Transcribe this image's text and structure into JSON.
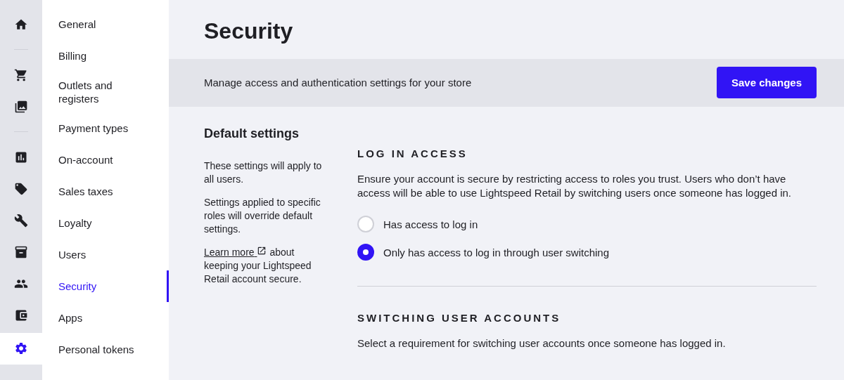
{
  "rail": [
    {
      "kind": "icon",
      "selected": false
    },
    {
      "kind": "divider"
    },
    {
      "kind": "icon",
      "selected": false
    },
    {
      "kind": "icon",
      "selected": false
    },
    {
      "kind": "divider"
    },
    {
      "kind": "icon",
      "selected": false
    },
    {
      "kind": "icon",
      "selected": false
    },
    {
      "kind": "icon",
      "selected": false
    },
    {
      "kind": "icon",
      "selected": false
    },
    {
      "kind": "icon",
      "selected": false
    },
    {
      "kind": "icon",
      "selected": false
    },
    {
      "kind": "icon",
      "selected": true
    }
  ],
  "nav": [
    {
      "label": "General",
      "selected": false
    },
    {
      "label": "Billing",
      "selected": false
    },
    {
      "label": "Outlets and registers",
      "selected": false
    },
    {
      "label": "Payment types",
      "selected": false
    },
    {
      "label": "On-account",
      "selected": false
    },
    {
      "label": "Sales taxes",
      "selected": false
    },
    {
      "label": "Loyalty",
      "selected": false
    },
    {
      "label": "Users",
      "selected": false
    },
    {
      "label": "Security",
      "selected": true
    },
    {
      "label": "Apps",
      "selected": false
    },
    {
      "label": "Personal tokens",
      "selected": false
    }
  ],
  "title": "Security",
  "banner": {
    "description": "Manage access and authentication settings for your store",
    "button": "Save changes"
  },
  "aside": {
    "heading": "Default settings",
    "paragraphs": [
      "These settings will apply to all users.",
      "Settings applied to specific roles will override default settings."
    ],
    "link": "Learn more",
    "link_suffix": "about keeping your Lightspeed Retail account secure."
  },
  "sections": [
    {
      "heading": "LOG IN ACCESS",
      "text": "Ensure your account is secure by restricting access to roles you trust. Users who don’t have access will be able to use Lightspeed Retail by switching users once someone has logged in.",
      "options": [
        {
          "label": "Has access to log in",
          "selected": false
        },
        {
          "label": "Only has access to log in through user switching",
          "selected": true
        }
      ]
    },
    {
      "heading": "SWITCHING USER ACCOUNTS",
      "text": "Select a requirement for switching user accounts once someone has logged in."
    }
  ]
}
